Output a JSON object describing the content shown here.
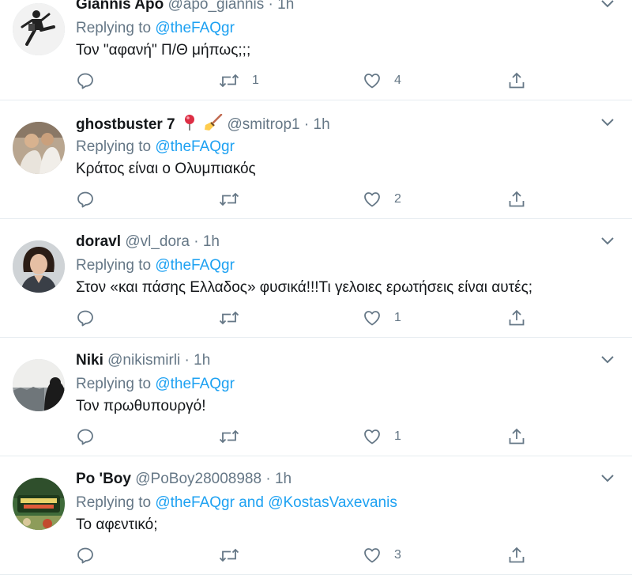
{
  "tweets": [
    {
      "name": "Giannis Apo",
      "handle": "@apo_giannis",
      "dot": "·",
      "time": "1h",
      "replying_label": "Replying to",
      "mentions": [
        "@theFAQgr"
      ],
      "mention_joiner": "",
      "text": "Τον \"αφανή\" Π/Θ μήπως;;;",
      "counts": {
        "reply": "",
        "retweet": "1",
        "like": "4"
      },
      "emoji": []
    },
    {
      "name": "ghostbuster 7",
      "handle": "@smitrop1",
      "dot": "·",
      "time": "1h",
      "replying_label": "Replying to",
      "mentions": [
        "@theFAQgr"
      ],
      "mention_joiner": "",
      "text": "Κράτος είναι ο Ολυμπιακός",
      "counts": {
        "reply": "",
        "retweet": "",
        "like": "2"
      },
      "emoji": [
        "round-pushpin-emoji",
        "broom-emoji"
      ]
    },
    {
      "name": "doravl",
      "handle": "@vl_dora",
      "dot": "·",
      "time": "1h",
      "replying_label": "Replying to",
      "mentions": [
        "@theFAQgr"
      ],
      "mention_joiner": "",
      "text": "Στον «και πάσης Ελλαδος» φυσικά!!!Τι γελοιες ερωτήσεις είναι αυτές;",
      "counts": {
        "reply": "",
        "retweet": "",
        "like": "1"
      },
      "emoji": []
    },
    {
      "name": "Niki",
      "handle": "@nikismirli",
      "dot": "·",
      "time": "1h",
      "replying_label": "Replying to",
      "mentions": [
        "@theFAQgr"
      ],
      "mention_joiner": "",
      "text": "Τον πρωθυπουργό!",
      "counts": {
        "reply": "",
        "retweet": "",
        "like": "1"
      },
      "emoji": []
    },
    {
      "name": "Po 'Boy",
      "handle": "@PoBoy28008988",
      "dot": "·",
      "time": "1h",
      "replying_label": "Replying to",
      "mentions": [
        "@theFAQgr",
        "@KostasVaxevanis"
      ],
      "mention_joiner": "and",
      "text": "Το αφεντικό;",
      "counts": {
        "reply": "",
        "retweet": "",
        "like": "3"
      },
      "emoji": []
    }
  ],
  "colors": {
    "link": "#1da1f2",
    "secondary_text": "#657786",
    "primary_text": "#14171a",
    "divider": "#e6ecf0"
  },
  "icons": {
    "reply": "reply-icon",
    "retweet": "retweet-icon",
    "like": "like-heart-icon",
    "share": "share-icon",
    "menu": "chevron-down-icon"
  }
}
